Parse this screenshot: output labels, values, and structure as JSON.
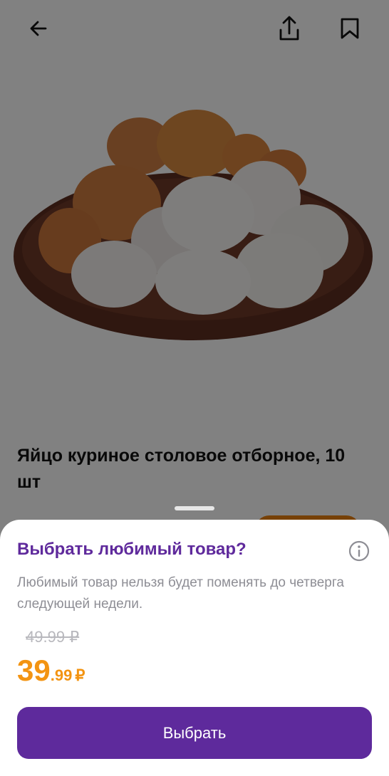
{
  "header": {
    "back_icon": "arrow-left-icon",
    "share_icon": "share-icon",
    "bookmark_icon": "bookmark-icon"
  },
  "product": {
    "title": "Яйцо куриное столовое отборное, 10 шт",
    "image_alt": "eggs in a bowl"
  },
  "sheet": {
    "title": "Выбрать любимый товар?",
    "info_icon": "info-icon",
    "description": "Любимый товар нельзя будет поменять до четверга следующей недели.",
    "old_price": "49.99 ₽",
    "price_int": "39",
    "price_frac": ".99",
    "price_currency": "₽",
    "button_label": "Выбрать"
  },
  "colors": {
    "accent_purple": "#5e2a9c",
    "price_orange": "#f39412",
    "muted_text": "#8e8e95"
  }
}
